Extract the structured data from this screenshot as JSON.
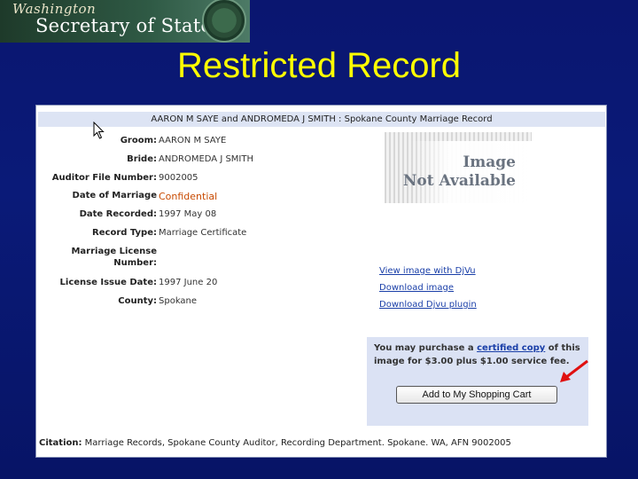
{
  "banner": {
    "state": "Washington",
    "office": "Secretary of State"
  },
  "slide": {
    "title": "Restricted Record"
  },
  "record": {
    "header": "AARON M SAYE and ANDROMEDA J SMITH : Spokane County Marriage Record",
    "fields": [
      {
        "label": "Groom:",
        "value": "AARON M SAYE"
      },
      {
        "label": "Bride:",
        "value": "ANDROMEDA J SMITH"
      },
      {
        "label": "Auditor File Number:",
        "value": "9002005"
      },
      {
        "label": "Date of Marriage",
        "value": "Confidential"
      },
      {
        "label": "Date Recorded:",
        "value": "1997 May 08"
      },
      {
        "label": "Record Type:",
        "value": "Marriage Certificate"
      },
      {
        "label": "Marriage License",
        "label2": "Number:",
        "value": ""
      },
      {
        "label": "License Issue Date:",
        "value": "1997 June 20"
      },
      {
        "label": "County:",
        "value": "Spokane"
      }
    ],
    "image_placeholder": {
      "line1": "Image",
      "line2": "Not Available"
    },
    "links": {
      "view": "View image with DjVu",
      "download_image": "Download image",
      "download_plugin": "Download Djvu plugin"
    },
    "purchase": {
      "text_before": "You may purchase a ",
      "certified_copy": "certified copy",
      "text_after": " of this image for $3.00 plus $1.00 service fee.",
      "button": "Add to My Shopping Cart"
    },
    "citation": {
      "label": "Citation:",
      "text": " Marriage Records, Spokane County Auditor, Recording Department. Spokane. WA, AFN 9002005"
    }
  },
  "colors": {
    "title": "#ffff00",
    "confidential": "#c84a00",
    "link": "#1a3fa8",
    "arrow": "#e01010"
  }
}
